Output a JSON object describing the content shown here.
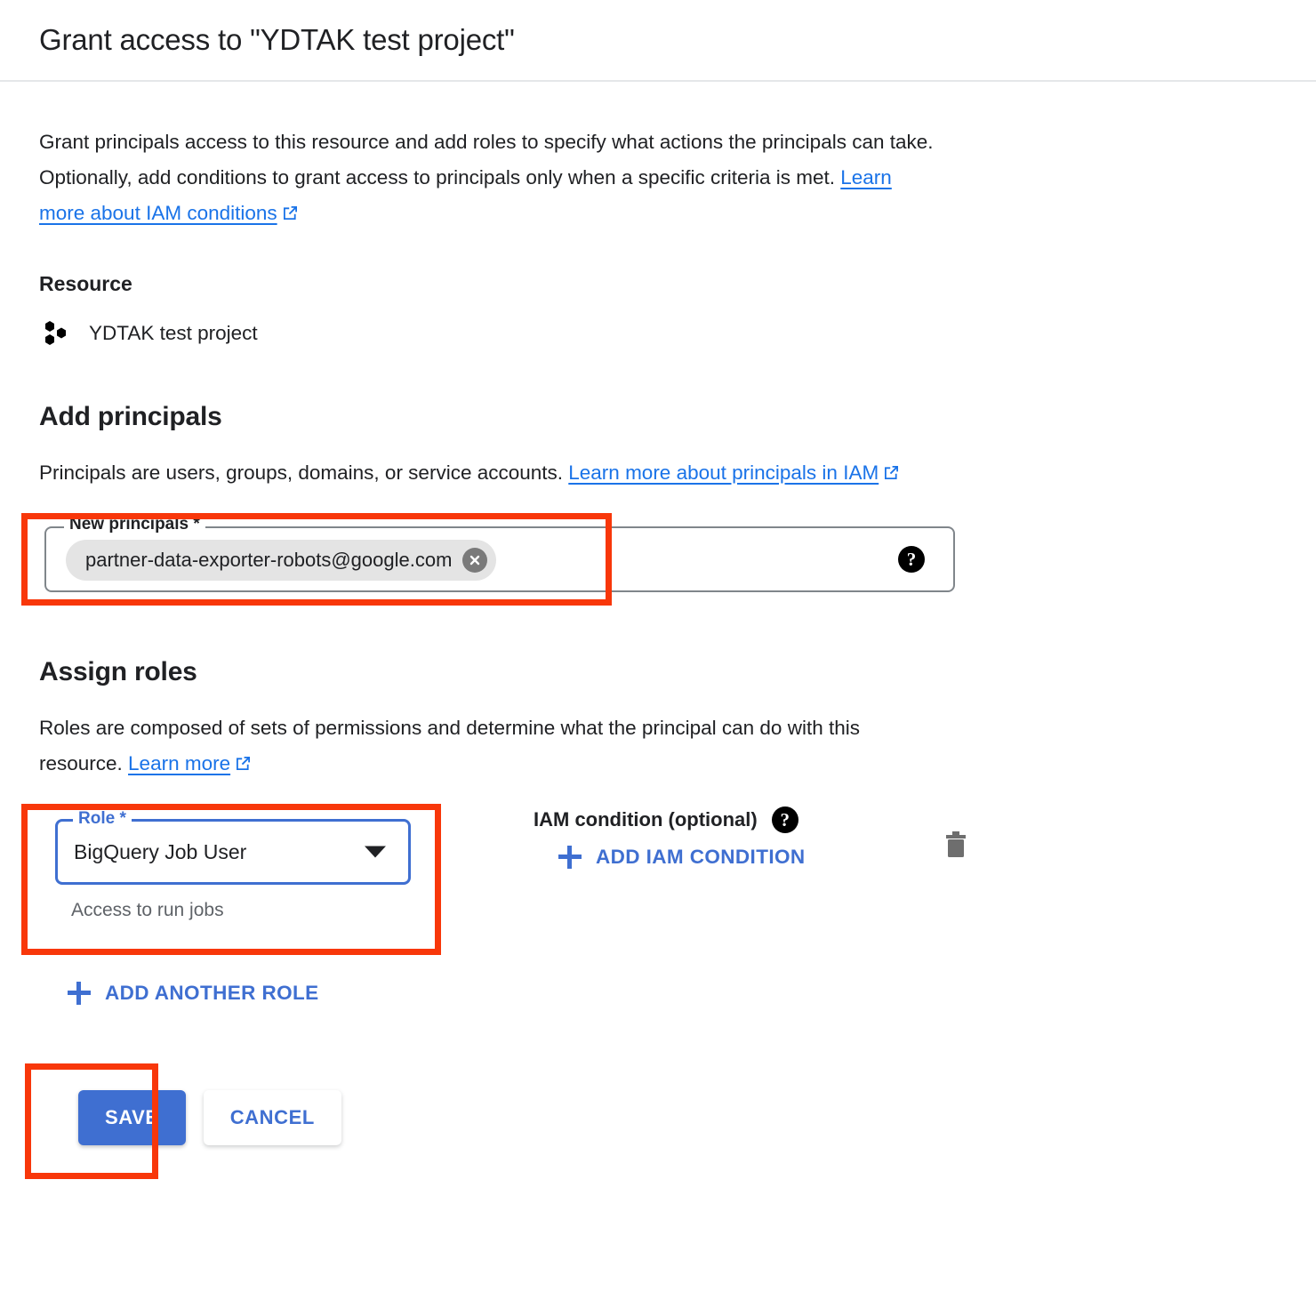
{
  "dialog": {
    "title": "Grant access to \"YDTAK test project\"",
    "intro_before_link": "Grant principals access to this resource and add roles to specify what actions the principals can take. Optionally, add conditions to grant access to principals only when a specific criteria is met. ",
    "intro_link": "Learn more about IAM conditions"
  },
  "resource": {
    "heading": "Resource",
    "icon": "cloud-project-icon",
    "name": "YDTAK test project"
  },
  "principals": {
    "heading": "Add principals",
    "desc_before_link": "Principals are users, groups, domains, or service accounts. ",
    "desc_link": "Learn more about principals in IAM",
    "field_label": "New principals *",
    "chip_value": "partner-data-exporter-robots@google.com",
    "chip_remove_icon": "close-icon",
    "help_icon": "help-icon",
    "placeholder": ""
  },
  "roles": {
    "heading": "Assign roles",
    "desc_before_link": "Roles are composed of sets of permissions and determine what the principal can do with this resource. ",
    "desc_link": "Learn more",
    "role_label": "Role *",
    "role_value": "BigQuery Job User",
    "role_hint": "Access to run jobs",
    "condition_label": "IAM condition (optional)",
    "condition_help_icon": "help-icon",
    "add_condition_label": "ADD IAM CONDITION",
    "delete_icon": "trash-icon",
    "add_another_role_label": "ADD ANOTHER ROLE"
  },
  "actions": {
    "save_label": "SAVE",
    "cancel_label": "CANCEL"
  },
  "colors": {
    "accent_blue": "#3f6fd1",
    "link_blue": "#1a73e8",
    "highlight_red": "#f8370a",
    "chip_gray": "#e4e4e4",
    "hint_gray": "#5f6368"
  }
}
